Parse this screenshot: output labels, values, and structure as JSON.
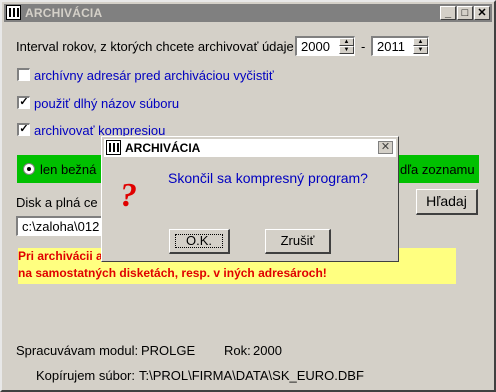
{
  "window": {
    "title": "ARCHIVÁCIA",
    "min_symbol": "_",
    "max_symbol": "□",
    "close_symbol": "✕"
  },
  "interval": {
    "label": "Interval rokov, z ktorých chcete archivovať údaje",
    "from": "2000",
    "separator": "-",
    "to": "2011"
  },
  "options": [
    {
      "label": "archívny adresár pred archiváciou vyčistiť",
      "checked": false,
      "mark": ""
    },
    {
      "label": "použiť dlhý názov súboru",
      "checked": true,
      "mark": "✓"
    },
    {
      "label": "archivovať kompresiou",
      "checked": true,
      "mark": "✓"
    }
  ],
  "radio_group": {
    "left_label": "len bežná",
    "right_label": "dľa zoznamu"
  },
  "disk": {
    "label": "Disk a plná ce",
    "path_value": "c:\\zaloha\\012",
    "search_button": "Hľadaj"
  },
  "warning": {
    "line1": "Pri archivácii                                                                              aná",
    "line2": "na samostatných disketách, resp. v iných adresároch!"
  },
  "status": {
    "module_label": "Spracuvávam modul:",
    "module": "PROLGE",
    "year_label": "Rok:",
    "year": "2000",
    "file_label": "Kopírujem súbor:",
    "file": "T:\\PROL\\FIRMA\\DATA\\SK_EURO.DBF"
  },
  "dialog": {
    "title": "ARCHIVÁCIA",
    "close_symbol": "✕",
    "icon_glyph": "?",
    "message": "Skončil sa kompresný program?",
    "ok": "O.K.",
    "cancel": "Zrušiť"
  }
}
